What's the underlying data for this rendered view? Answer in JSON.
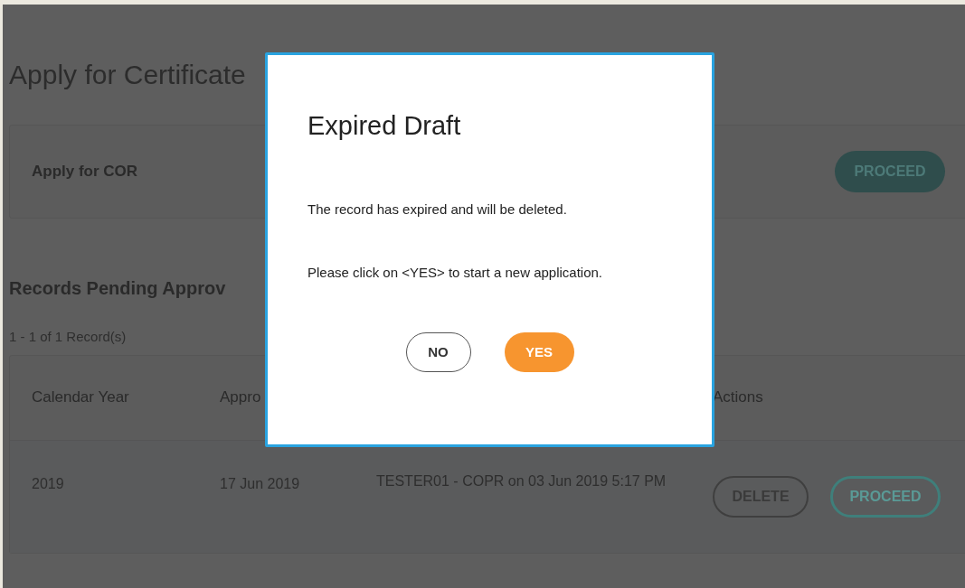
{
  "page": {
    "title": "Apply for Certificate"
  },
  "apply_card": {
    "label": "Apply for COR",
    "button": "PROCEED"
  },
  "records": {
    "heading": "Records Pending Approv",
    "count": "1 - 1 of 1 Record(s)",
    "columns": [
      "Calendar Year",
      "Appro",
      "Actions"
    ],
    "rows": [
      {
        "calendar_year": "2019",
        "column_2": "17 Jun 2019",
        "column_3": "TESTER01 - COPR on 03 Jun 2019 5:17 PM",
        "actions": [
          {
            "label": "DELETE",
            "kind": "outline"
          },
          {
            "label": "PROCEED",
            "kind": "accent"
          }
        ]
      }
    ]
  },
  "dialog": {
    "title": "Expired Draft",
    "messages": [
      "The record has expired and will be deleted.",
      "Please click on <YES> to start a new application."
    ],
    "buttons": [
      {
        "label": "NO",
        "kind": "secondary"
      },
      {
        "label": "YES",
        "kind": "primary"
      }
    ]
  }
}
